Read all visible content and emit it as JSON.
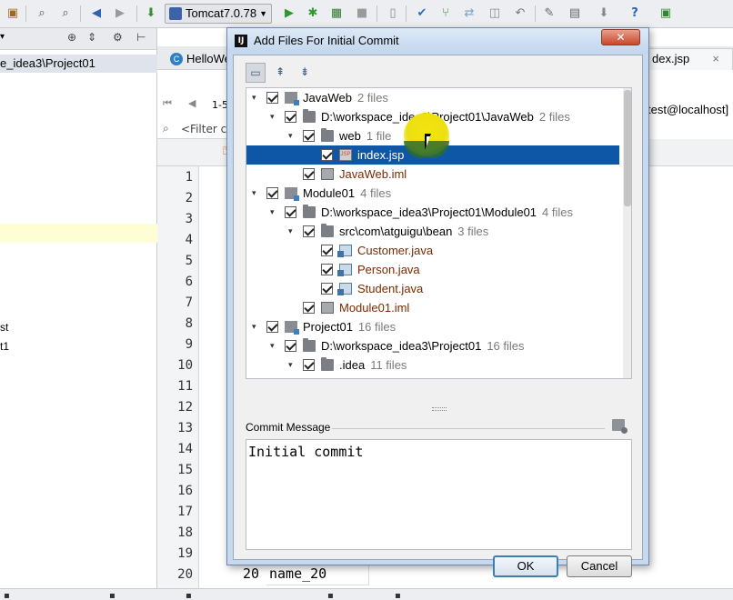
{
  "toolbar": {
    "run_config": "Tomcat7.0.78"
  },
  "project_panel": {
    "path_label": "e_idea3\\Project01",
    "fragments": [
      "st",
      "t1"
    ]
  },
  "editor": {
    "tab_hello": "HelloWe",
    "tab_index": "dex.jsp",
    "tab_close": "×",
    "db_tab": "test@localhost]",
    "page_label": "1-5",
    "filter_text": "<Filter cr",
    "line_numbers": [
      "1",
      "2",
      "3",
      "4",
      "5",
      "6",
      "7",
      "8",
      "9",
      "10",
      "11",
      "12",
      "13",
      "14",
      "15",
      "16",
      "17",
      "18",
      "19",
      "20"
    ],
    "row20_id": "20",
    "row20_name": "name_20"
  },
  "dialog": {
    "title": "Add Files For Initial Commit",
    "close_glyph": "✕",
    "tree": [
      {
        "name": "JavaWeb",
        "count": "2 files",
        "kind": "module",
        "path": false
      },
      {
        "name": "D:\\workspace_idea3\\Project01\\JavaWeb",
        "count": "2 files",
        "kind": "folder"
      },
      {
        "name": "web",
        "count": "1 file",
        "kind": "folder"
      },
      {
        "name": "index.jsp",
        "count": "",
        "kind": "jsp",
        "selected": true
      },
      {
        "name": "JavaWeb.iml",
        "count": "",
        "kind": "iml"
      },
      {
        "name": "Module01",
        "count": "4 files",
        "kind": "module"
      },
      {
        "name": "D:\\workspace_idea3\\Project01\\Module01",
        "count": "4 files",
        "kind": "folder"
      },
      {
        "name": "src\\com\\atguigu\\bean",
        "count": "3 files",
        "kind": "folder"
      },
      {
        "name": "Customer.java",
        "count": "",
        "kind": "java"
      },
      {
        "name": "Person.java",
        "count": "",
        "kind": "java"
      },
      {
        "name": "Student.java",
        "count": "",
        "kind": "java"
      },
      {
        "name": "Module01.iml",
        "count": "",
        "kind": "iml"
      },
      {
        "name": "Project01",
        "count": "16 files",
        "kind": "module"
      },
      {
        "name": "D:\\workspace_idea3\\Project01",
        "count": "16 files",
        "kind": "folder"
      },
      {
        "name": ".idea",
        "count": "11 files",
        "kind": "folder"
      }
    ],
    "commit_message_label": "Commit Message",
    "commit_message": "Initial commit",
    "ok_label": "OK",
    "cancel_label": "Cancel"
  },
  "icons": {
    "tree_toolbar": [
      "group-by-directory-icon",
      "expand-all-icon",
      "collapse-all-icon"
    ],
    "history": "commit-message-history-icon"
  },
  "colors": {
    "selection": "#0e57a6",
    "dialog_frame": "#c7d9ee",
    "close_button": "#c8462c"
  }
}
